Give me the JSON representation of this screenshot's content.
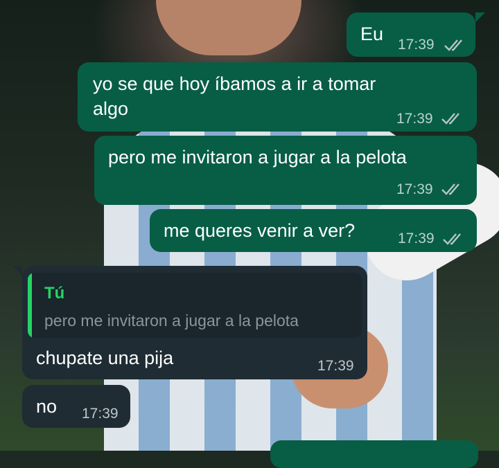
{
  "colors": {
    "outgoing_bubble": "#075e45",
    "incoming_bubble": "#1f2c34",
    "reply_accent": "#25d366"
  },
  "messages": [
    {
      "text": "Eu",
      "time": "17:39",
      "status": "read-icon"
    },
    {
      "text": "yo se que hoy íbamos a ir a tomar\nalgo",
      "line1": "yo se que hoy íbamos a ir a tomar",
      "line2": "algo",
      "time": "17:39",
      "status": "read-icon"
    },
    {
      "text": "pero me invitaron a jugar a la pelota",
      "time": "17:39",
      "status": "read-icon"
    },
    {
      "text": "me queres venir a ver?",
      "time": "17:39",
      "status": "read-icon"
    },
    {
      "reply_to_name": "Tú",
      "reply_to_text": "pero me invitaron a jugar a la pelota",
      "text": "chupate una pija",
      "time": "17:39"
    },
    {
      "text": "no",
      "time": "17:39"
    }
  ]
}
